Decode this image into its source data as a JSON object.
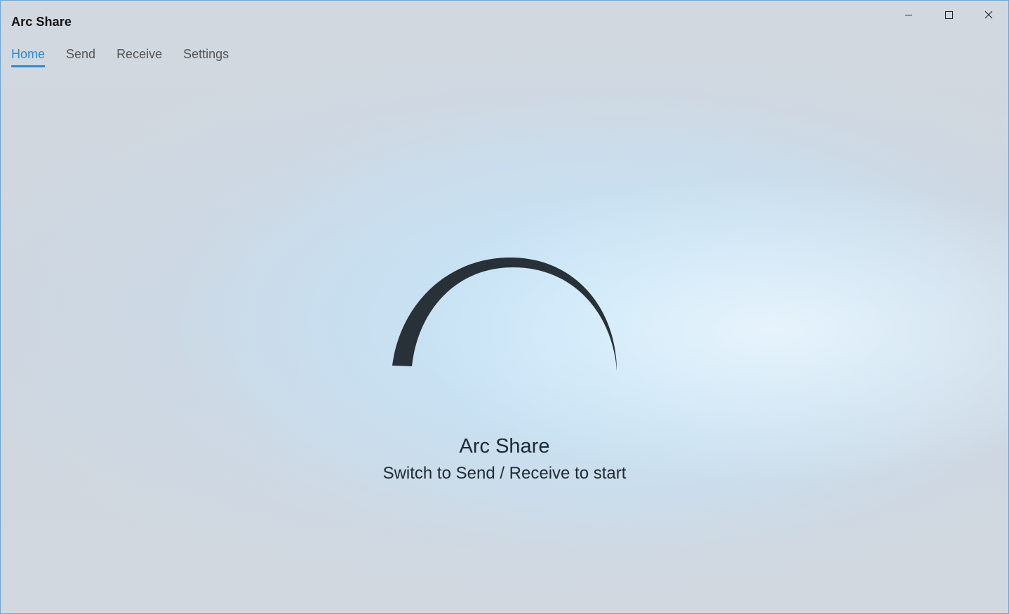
{
  "window": {
    "title": "Arc Share"
  },
  "window_controls": {
    "icons": [
      "minimize-icon",
      "maximize-icon",
      "close-icon"
    ]
  },
  "nav": {
    "active": "Home",
    "items": [
      {
        "label": "Home"
      },
      {
        "label": "Send"
      },
      {
        "label": "Receive"
      },
      {
        "label": "Settings"
      }
    ]
  },
  "hero": {
    "title": "Arc Share",
    "subtitle": "Switch to Send / Receive to start"
  },
  "colors": {
    "accent": "#2a8ad6",
    "arc": "#283038",
    "text": "#1f2a33"
  }
}
